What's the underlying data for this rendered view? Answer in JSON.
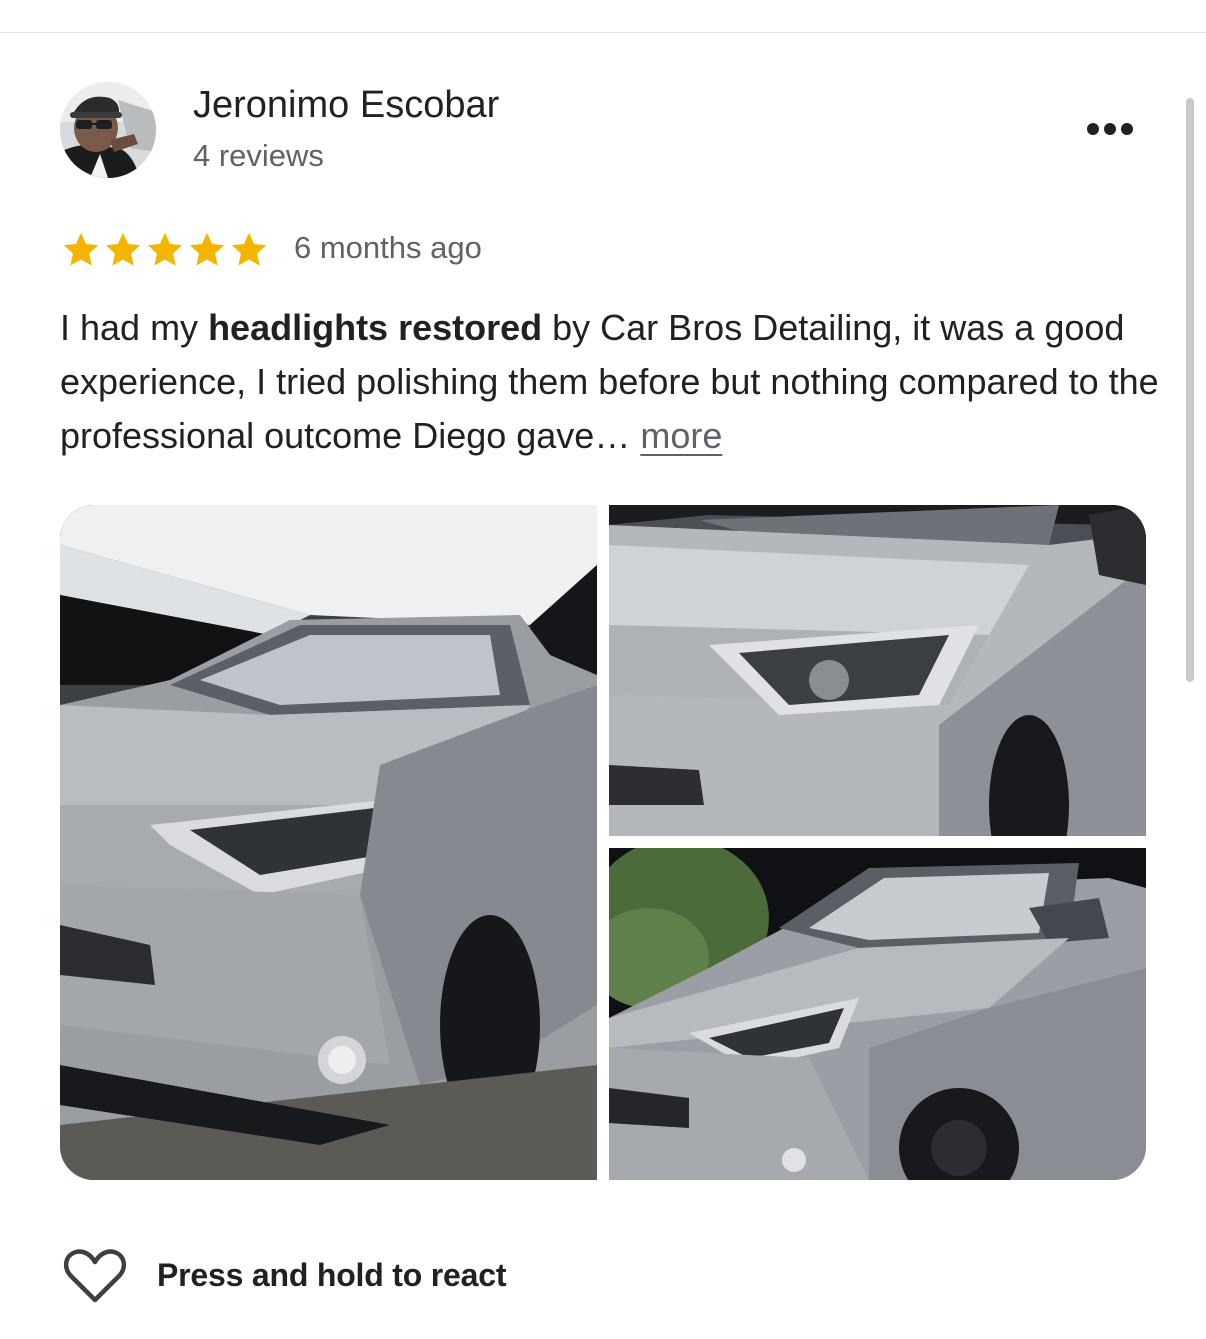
{
  "reviewer": {
    "name": "Jeronimo Escobar",
    "review_count": "4 reviews"
  },
  "review": {
    "rating": 5,
    "max_rating": 5,
    "date": "6 months ago",
    "text_prefix": "I had my ",
    "text_bold": "headlights restored",
    "text_suffix": " by Car Bros Detailing, it was a good experience, I tried polishing them before but nothing compared to the professional outcome Diego gave… ",
    "more_label": "more"
  },
  "actions": {
    "react_label": "Press and hold to react"
  },
  "icons": {
    "menu": "more-horizontal-icon",
    "star": "star-icon",
    "react": "heart-outline-icon"
  },
  "colors": {
    "star": "#f4b400",
    "text": "#202124",
    "secondary_text": "#5f6368"
  }
}
